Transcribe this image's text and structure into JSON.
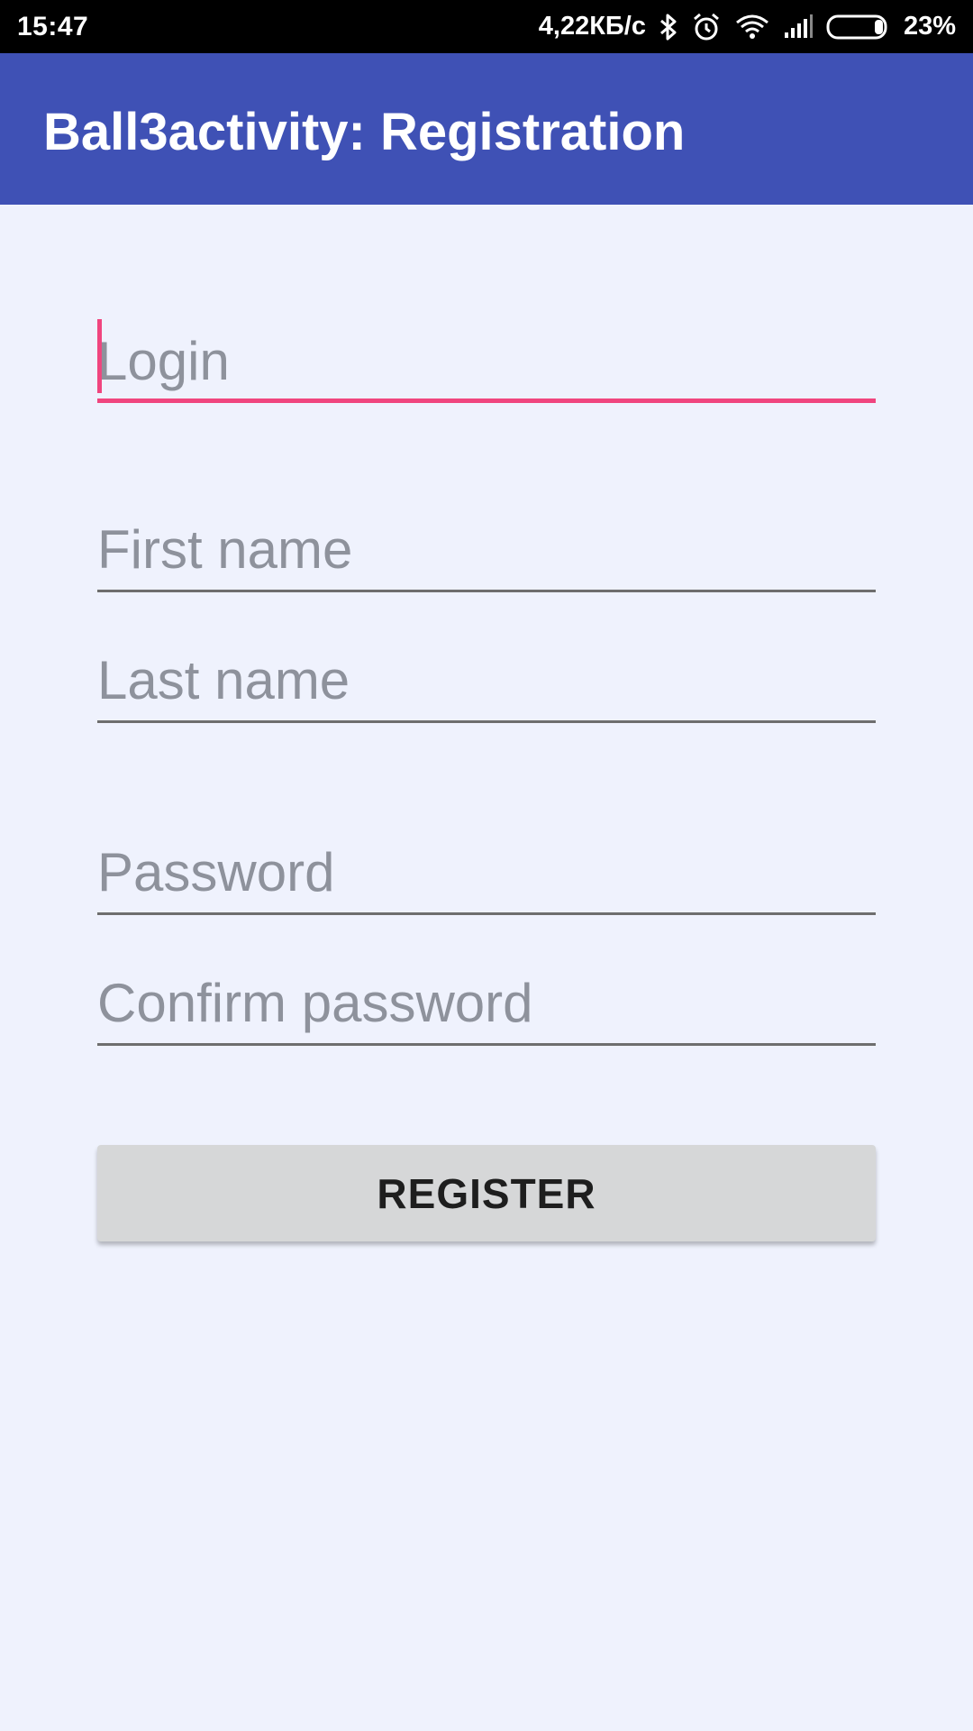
{
  "status_bar": {
    "time": "15:47",
    "speed": "4,22КБ/с",
    "battery": "23%",
    "icons": [
      "bluetooth-icon",
      "alarm-icon",
      "wifi-icon",
      "signal-icon",
      "battery-icon"
    ]
  },
  "app_bar": {
    "title": "Ball3activity: Registration",
    "color": "#3f51b5"
  },
  "form": {
    "login_placeholder": "Login",
    "first_name_placeholder": "First name",
    "last_name_placeholder": "Last name",
    "password_placeholder": "Password",
    "confirm_password_placeholder": "Confirm password",
    "register_label": "REGISTER",
    "accent_color": "#f0457f"
  }
}
